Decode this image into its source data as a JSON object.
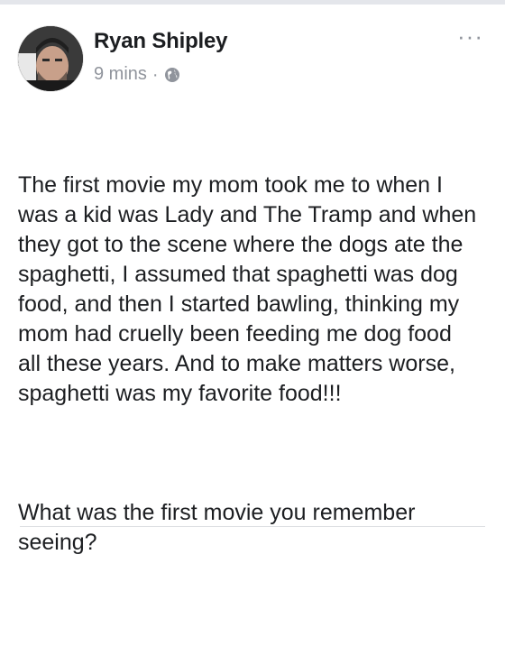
{
  "post": {
    "author": "Ryan Shipley",
    "timestamp": "9 mins",
    "separator": "·",
    "privacy_icon": "globe-icon",
    "more_label": "···",
    "paragraphs": [
      "The first movie my mom took me to when I was a kid was Lady and The Tramp and when they got to the scene where the dogs ate the spaghetti, I assumed that spaghetti was dog food, and then I started bawling, thinking my mom had cruelly been feeding me dog food all these years. And to make matters worse, spaghetti was my favorite food!!!",
      "What was the first movie you remember seeing?"
    ]
  },
  "colors": {
    "text": "#1c1e21",
    "meta": "#90949c",
    "top_bar": "#e4e6eb",
    "divider": "#dddfe2"
  }
}
